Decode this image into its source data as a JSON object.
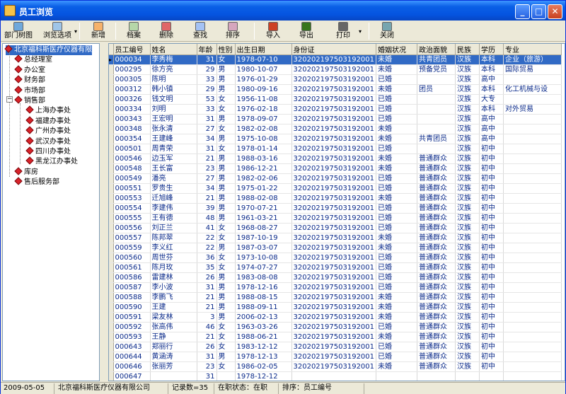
{
  "window": {
    "title": "员工浏览"
  },
  "toolbar": [
    {
      "name": "dept-tree-button",
      "label": "部门树图",
      "color": "#6fa8dc"
    },
    {
      "name": "browse-options-button",
      "label": "浏览选项",
      "color": "#9fc5e8",
      "dropdown": true
    },
    {
      "name": "add-button",
      "label": "新增",
      "color": "#f6b26b"
    },
    {
      "name": "archive-button",
      "label": "档案",
      "color": "#b6d7a8"
    },
    {
      "name": "delete-button",
      "label": "删除",
      "color": "#e06666"
    },
    {
      "name": "find-button",
      "label": "查找",
      "color": "#a4c2f4"
    },
    {
      "name": "sort-button",
      "label": "排序",
      "color": "#d5a6bd"
    },
    {
      "name": "import-button",
      "label": "导入",
      "color": "#cc4125"
    },
    {
      "name": "export-button",
      "label": "导出",
      "color": "#38761d"
    },
    {
      "name": "print-button",
      "label": "打印",
      "color": "#666666",
      "dropdown": true
    },
    {
      "name": "close-button",
      "label": "关闭",
      "color": "#76a5af"
    }
  ],
  "tree": [
    {
      "label": "北京福科斯医疗仪器有限",
      "level": 0,
      "selected": true
    },
    {
      "label": "总经理室",
      "level": 1
    },
    {
      "label": "办公室",
      "level": 1
    },
    {
      "label": "财务部",
      "level": 1
    },
    {
      "label": "市场部",
      "level": 1
    },
    {
      "label": "销售部",
      "level": 1
    },
    {
      "label": "上海办事处",
      "level": 2
    },
    {
      "label": "福建办事处",
      "level": 2
    },
    {
      "label": "广州办事处",
      "level": 2
    },
    {
      "label": "武汉办事处",
      "level": 2
    },
    {
      "label": "四川办事处",
      "level": 2
    },
    {
      "label": "黑龙江办事处",
      "level": 2
    },
    {
      "label": "库房",
      "level": 1
    },
    {
      "label": "售后服务部",
      "level": 1
    }
  ],
  "columns": [
    "员工编号",
    "姓名",
    "年龄",
    "性别",
    "出生日期",
    "身份证",
    "婚姻状况",
    "政治面貌",
    "民族",
    "学历",
    "专业"
  ],
  "rows": [
    [
      "000034",
      "李秀梅",
      "31",
      "女",
      "1978-07-10",
      "320202197503192001",
      "未婚",
      "共青团员",
      "汉族",
      "本科",
      "企业（旅游）"
    ],
    [
      "000295",
      "徐方亮",
      "29",
      "男",
      "1980-10-07",
      "320202197503192001",
      "未婚",
      "预备党员",
      "汉族",
      "本科",
      "国际贸易"
    ],
    [
      "000305",
      "陈明",
      "33",
      "男",
      "1976-01-29",
      "320202197503192001",
      "已婚",
      "",
      "汉族",
      "高中",
      ""
    ],
    [
      "000312",
      "韩小镇",
      "29",
      "男",
      "1980-09-16",
      "320202197503192001",
      "未婚",
      "团员",
      "汉族",
      "本科",
      "化工机械与设"
    ],
    [
      "000326",
      "钱文明",
      "53",
      "女",
      "1956-11-08",
      "320202197503192001",
      "已婚",
      "",
      "汉族",
      "大专",
      ""
    ],
    [
      "000334",
      "刘明",
      "33",
      "女",
      "1976-02-18",
      "320202197503192001",
      "已婚",
      "",
      "汉族",
      "本科",
      "对外贸易"
    ],
    [
      "000343",
      "王宏明",
      "31",
      "男",
      "1978-09-07",
      "320202197503192001",
      "已婚",
      "",
      "汉族",
      "高中",
      ""
    ],
    [
      "000348",
      "张永清",
      "27",
      "女",
      "1982-02-08",
      "320202197503192001",
      "未婚",
      "",
      "汉族",
      "高中",
      ""
    ],
    [
      "000354",
      "王建峰",
      "34",
      "男",
      "1975-10-08",
      "320202197503192001",
      "未婚",
      "共青团员",
      "汉族",
      "高中",
      ""
    ],
    [
      "000501",
      "周青荣",
      "31",
      "女",
      "1978-01-14",
      "320202197503192001",
      "已婚",
      "",
      "汉族",
      "初中",
      ""
    ],
    [
      "000546",
      "边玉军",
      "21",
      "男",
      "1988-03-16",
      "320202197503192001",
      "未婚",
      "普通群众",
      "汉族",
      "初中",
      ""
    ],
    [
      "000548",
      "王长富",
      "23",
      "男",
      "1986-12-21",
      "320202197503192001",
      "未婚",
      "普通群众",
      "汉族",
      "初中",
      ""
    ],
    [
      "000549",
      "潘亮",
      "27",
      "男",
      "1982-02-06",
      "320202197503192001",
      "已婚",
      "普通群众",
      "汉族",
      "初中",
      ""
    ],
    [
      "000551",
      "罗贵生",
      "34",
      "男",
      "1975-01-22",
      "320202197503192001",
      "已婚",
      "普通群众",
      "汉族",
      "初中",
      ""
    ],
    [
      "000553",
      "迁旭峰",
      "21",
      "男",
      "1988-02-08",
      "320202197503192001",
      "未婚",
      "普通群众",
      "汉族",
      "初中",
      ""
    ],
    [
      "000554",
      "李建伟",
      "39",
      "男",
      "1970-07-21",
      "320202197503192001",
      "已婚",
      "普通群众",
      "汉族",
      "初中",
      ""
    ],
    [
      "000555",
      "王有德",
      "48",
      "男",
      "1961-03-21",
      "320202197503192001",
      "已婚",
      "普通群众",
      "汉族",
      "初中",
      ""
    ],
    [
      "000556",
      "刘正兰",
      "41",
      "女",
      "1968-08-27",
      "320202197503192001",
      "已婚",
      "普通群众",
      "汉族",
      "初中",
      ""
    ],
    [
      "000557",
      "陈邦翠",
      "22",
      "女",
      "1987-10-19",
      "320202197503192001",
      "未婚",
      "普通群众",
      "汉族",
      "初中",
      ""
    ],
    [
      "000559",
      "李义红",
      "22",
      "男",
      "1987-03-07",
      "320202197503192001",
      "未婚",
      "普通群众",
      "汉族",
      "初中",
      ""
    ],
    [
      "000560",
      "周世芬",
      "36",
      "女",
      "1973-10-08",
      "320202197503192001",
      "已婚",
      "普通群众",
      "汉族",
      "初中",
      ""
    ],
    [
      "000561",
      "陈月玫",
      "35",
      "女",
      "1974-07-27",
      "320202197503192001",
      "已婚",
      "普通群众",
      "汉族",
      "初中",
      ""
    ],
    [
      "000586",
      "雷建林",
      "26",
      "男",
      "1983-08-08",
      "320202197503192001",
      "已婚",
      "普通群众",
      "汉族",
      "初中",
      ""
    ],
    [
      "000587",
      "李小波",
      "31",
      "男",
      "1978-12-16",
      "320202197503192001",
      "已婚",
      "普通群众",
      "汉族",
      "初中",
      ""
    ],
    [
      "000588",
      "李鹏飞",
      "21",
      "男",
      "1988-08-15",
      "320202197503192001",
      "未婚",
      "普通群众",
      "汉族",
      "初中",
      ""
    ],
    [
      "000590",
      "王建",
      "21",
      "男",
      "1988-09-11",
      "320202197503192001",
      "未婚",
      "普通群众",
      "汉族",
      "初中",
      ""
    ],
    [
      "000591",
      "梁友林",
      "3",
      "男",
      "2006-02-13",
      "320202197503192001",
      "未婚",
      "普通群众",
      "汉族",
      "初中",
      ""
    ],
    [
      "000592",
      "张高伟",
      "46",
      "女",
      "1963-03-26",
      "320202197503192001",
      "已婚",
      "普通群众",
      "汉族",
      "初中",
      ""
    ],
    [
      "000593",
      "王静",
      "21",
      "女",
      "1988-06-21",
      "320202197503192001",
      "未婚",
      "普通群众",
      "汉族",
      "初中",
      ""
    ],
    [
      "000643",
      "郑丽行",
      "26",
      "女",
      "1983-12-12",
      "320202197503192001",
      "已婚",
      "普通群众",
      "汉族",
      "初中",
      ""
    ],
    [
      "000644",
      "黄涵涛",
      "31",
      "男",
      "1978-12-13",
      "320202197503192001",
      "已婚",
      "普通群众",
      "汉族",
      "初中",
      ""
    ],
    [
      "000646",
      "张丽芳",
      "23",
      "女",
      "1986-02-05",
      "320202197503192001",
      "未婚",
      "普通群众",
      "汉族",
      "初中",
      ""
    ],
    [
      "000647",
      "",
      "31",
      "",
      "1978-12-12",
      "",
      "",
      "",
      "",
      "",
      ""
    ]
  ],
  "status": {
    "date": "2009-05-05",
    "company": "北京福科斯医疗仪器有限公司",
    "record_count": "记录数=35",
    "employment_status": "在职状态：在职",
    "sort": "排序：员工编号"
  },
  "colors": {
    "titlebar": "#0554e0",
    "selection": "#316ac5",
    "tree_diamond": "#d8232a",
    "cell_text": "#0a2a8a"
  }
}
